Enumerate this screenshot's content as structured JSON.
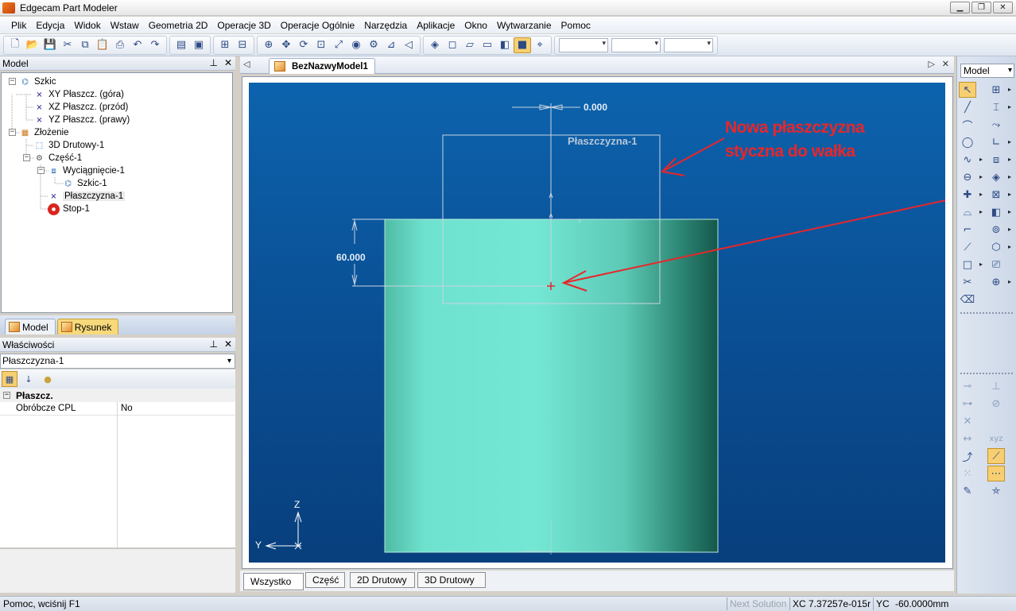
{
  "window": {
    "title": "Edgecam Part Modeler"
  },
  "menu": [
    {
      "label": "Plik"
    },
    {
      "label": "Edycja"
    },
    {
      "label": "Widok"
    },
    {
      "label": "Wstaw"
    },
    {
      "label": "Geometria 2D"
    },
    {
      "label": "Operacje 3D"
    },
    {
      "label": "Operacje Ogólnie"
    },
    {
      "label": "Narzędzia"
    },
    {
      "label": "Aplikacje"
    },
    {
      "label": "Okno"
    },
    {
      "label": "Wytwarzanie"
    },
    {
      "label": "Pomoc"
    }
  ],
  "model_panel": {
    "title": "Model",
    "tree": [
      {
        "label": "Szkic",
        "icon": "sketch-icon"
      },
      {
        "label": "XY Płaszcz. (góra)",
        "icon": "plane-icon"
      },
      {
        "label": "XZ Płaszcz. (przód)",
        "icon": "plane-icon"
      },
      {
        "label": "YZ Płaszcz. (prawy)",
        "icon": "plane-icon"
      },
      {
        "label": "Złożenie",
        "icon": "assembly-icon"
      },
      {
        "label": "3D Drutowy-1",
        "icon": "wireframe-icon"
      },
      {
        "label": "Część-1",
        "icon": "part-icon"
      },
      {
        "label": "Wyciągnięcie-1",
        "icon": "extrude-icon"
      },
      {
        "label": "Szkic-1",
        "icon": "sketch-icon"
      },
      {
        "label": "Płaszczyzna-1",
        "icon": "plane-icon"
      },
      {
        "label": "Stop-1",
        "icon": "stop-icon"
      }
    ],
    "tabs": [
      {
        "label": "Model"
      },
      {
        "label": "Rysunek"
      }
    ]
  },
  "properties_panel": {
    "title": "Właściwości",
    "selected": "Płaszczyzna-1",
    "category": "Płaszcz.",
    "rows": [
      {
        "key": "Obróbcze CPL",
        "value": "No"
      }
    ]
  },
  "document": {
    "tab": "BezNazwyModel1",
    "view_tabs": [
      {
        "label": "Wszystko"
      },
      {
        "label": "Część"
      },
      {
        "label": "2D Drutowy"
      },
      {
        "label": "3D Drutowy"
      }
    ]
  },
  "viewport": {
    "dim_top": "0.000",
    "dim_left": "60.000",
    "plane_label": "Płaszczyzna-1",
    "annotation_line1": "Nowa płaszczyzna",
    "annotation_line2": "styczna do wałka",
    "axis_z": "Z",
    "axis_y": "Y",
    "annotation_color": "#e8262b",
    "cylinder_color": "#6fe2cf"
  },
  "right_toolbar": {
    "mode": "Model"
  },
  "status": {
    "help": "Pomoc, wciśnij F1",
    "next_solution": "Next Solution",
    "xc": "XC 7.37257e-015r",
    "yc": "YC",
    "yc_value": "-60.0000mm"
  }
}
